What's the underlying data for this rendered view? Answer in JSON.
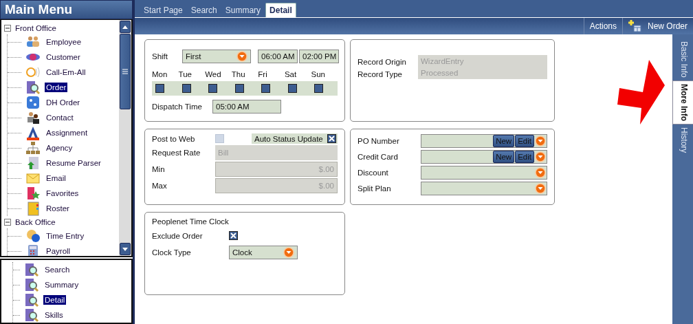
{
  "sidebar": {
    "title": "Main Menu",
    "tree": [
      {
        "label": "Front Office",
        "expanded": true,
        "children": [
          {
            "label": "Employee",
            "selected": false
          },
          {
            "label": "Customer",
            "selected": false
          },
          {
            "label": "Call-Em-All",
            "selected": false
          },
          {
            "label": "Order",
            "selected": true
          },
          {
            "label": "DH Order",
            "selected": false
          },
          {
            "label": "Contact",
            "selected": false
          },
          {
            "label": "Assignment",
            "selected": false
          },
          {
            "label": "Agency",
            "selected": false
          },
          {
            "label": "Resume Parser",
            "selected": false
          },
          {
            "label": "Email",
            "selected": false
          },
          {
            "label": "Favorites",
            "selected": false
          },
          {
            "label": "Roster",
            "selected": false
          }
        ]
      },
      {
        "label": "Back Office",
        "expanded": true,
        "children": [
          {
            "label": "Time Entry",
            "selected": false
          },
          {
            "label": "Payroll",
            "selected": false
          }
        ]
      }
    ],
    "list": [
      {
        "label": "Search",
        "selected": false
      },
      {
        "label": "Summary",
        "selected": false
      },
      {
        "label": "Detail",
        "selected": true
      },
      {
        "label": "Skills",
        "selected": false
      }
    ]
  },
  "tabs": [
    {
      "label": "Start Page",
      "selected": false
    },
    {
      "label": "Search",
      "selected": false
    },
    {
      "label": "Summary",
      "selected": false
    },
    {
      "label": "Detail",
      "selected": true
    }
  ],
  "toolbar": {
    "actions": "Actions",
    "new_order": "New Order"
  },
  "side_tabs": [
    {
      "label": "Basic Info",
      "selected": false
    },
    {
      "label": "More Info",
      "selected": true
    },
    {
      "label": "History",
      "selected": false
    }
  ],
  "shift": {
    "label": "Shift",
    "value": "First",
    "start": "06:00 AM",
    "end": "02:00 PM",
    "days": [
      {
        "label": "Mon",
        "checked": false
      },
      {
        "label": "Tue",
        "checked": false
      },
      {
        "label": "Wed",
        "checked": false
      },
      {
        "label": "Thu",
        "checked": false
      },
      {
        "label": "Fri",
        "checked": false
      },
      {
        "label": "Sat",
        "checked": false
      },
      {
        "label": "Sun",
        "checked": false
      }
    ],
    "dispatch_label": "Dispatch Time",
    "dispatch_value": "05:00 AM"
  },
  "record": {
    "origin_label": "Record Origin",
    "origin_value": "WizardEntry",
    "type_label": "Record Type",
    "type_value": "Processed"
  },
  "web": {
    "post_label": "Post to Web",
    "post_checked": false,
    "post_disabled": true,
    "auto_label": "Auto Status Update",
    "auto_checked": true,
    "rate_label": "Request Rate",
    "rate_value": "Bill",
    "min_label": "Min",
    "min_value": "$.00",
    "max_label": "Max",
    "max_value": "$.00"
  },
  "lookups": [
    {
      "label": "PO Number",
      "kind": "buttons",
      "buttons": [
        "New",
        "Edit"
      ]
    },
    {
      "label": "Credit Card",
      "kind": "buttons",
      "buttons": [
        "New",
        "Edit"
      ]
    },
    {
      "label": "Discount",
      "kind": "plain"
    },
    {
      "label": "Split Plan",
      "kind": "plain"
    }
  ],
  "clock": {
    "title": "Peoplenet Time Clock",
    "exclude_label": "Exclude Order",
    "exclude_checked": true,
    "type_label": "Clock Type",
    "type_value": "Clock"
  }
}
